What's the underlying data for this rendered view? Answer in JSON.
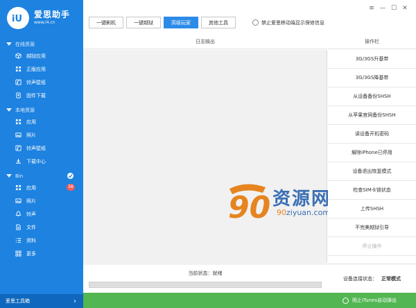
{
  "app": {
    "name": "爱思助手",
    "url": "www.i4.cn",
    "logo_text": "iU"
  },
  "window_controls": {
    "menu": "≡",
    "minimize": "—",
    "maximize": "☐",
    "close": "✕"
  },
  "sidebar": {
    "sections": [
      {
        "title": "在线资源",
        "items": [
          {
            "label": "越狱应用",
            "icon": "app-box-icon"
          },
          {
            "label": "正版应用",
            "icon": "apps-grid-icon"
          },
          {
            "label": "铃声壁纸",
            "icon": "ringtone-icon"
          },
          {
            "label": "固件下载",
            "icon": "firmware-icon"
          }
        ]
      },
      {
        "title": "本地资源",
        "items": [
          {
            "label": "应用",
            "icon": "apps-grid-icon"
          },
          {
            "label": "照片",
            "icon": "photo-icon"
          },
          {
            "label": "铃声壁纸",
            "icon": "ringtone-icon"
          },
          {
            "label": "下载中心",
            "icon": "download-icon"
          }
        ]
      },
      {
        "title": "Bin",
        "items": [
          {
            "label": "应用",
            "icon": "apps-grid-icon",
            "badge": "38"
          },
          {
            "label": "照片",
            "icon": "photo-icon"
          },
          {
            "label": "铃声",
            "icon": "bell-icon"
          },
          {
            "label": "文件",
            "icon": "file-icon"
          },
          {
            "label": "资料",
            "icon": "list-icon"
          },
          {
            "label": "更多",
            "icon": "more-icon"
          }
        ]
      }
    ],
    "footer": {
      "label": "爱思工具箱",
      "arrow": "›"
    }
  },
  "toolbar": {
    "tabs": [
      "一键刷机",
      "一键越狱",
      "高级玩家",
      "其他工具"
    ],
    "active_tab": "高级玩家",
    "checkbox_label": "禁止爱思移动端显示保修信息"
  },
  "log": {
    "header": "日志输出",
    "status_label": "当前状态：就绪",
    "progress": 0
  },
  "watermark": {
    "logo_number": "90",
    "title": "资源网",
    "url_prefix": "90",
    "url_rest": "ziyuan.com"
  },
  "operations": {
    "header": "操作栏",
    "items": [
      {
        "label": "3G/3GS升基带",
        "enabled": true
      },
      {
        "label": "3G/3GS降基带",
        "enabled": true
      },
      {
        "label": "从设备备份SHSH",
        "enabled": true
      },
      {
        "label": "从苹果官网备份SHSH",
        "enabled": true
      },
      {
        "label": "读设备开机密码",
        "enabled": true
      },
      {
        "label": "解除iPhone已停用",
        "enabled": true
      },
      {
        "label": "设备退出恢复模式",
        "enabled": true
      },
      {
        "label": "检查SIM卡锁状态",
        "enabled": true
      },
      {
        "label": "上传SHSH",
        "enabled": true
      },
      {
        "label": "不完美越狱引导",
        "enabled": true
      },
      {
        "label": "停止操作",
        "enabled": false
      }
    ],
    "connection_label": "设备连接状态：",
    "connection_value": "正常模式"
  },
  "bottombar": {
    "checkbox_label": "阻止iTunes自动弹出"
  },
  "colors": {
    "sidebar": "#1d82e0",
    "accent": "#2d8be8",
    "bottom_bar": "#52b652",
    "badge": "#f25a58"
  }
}
